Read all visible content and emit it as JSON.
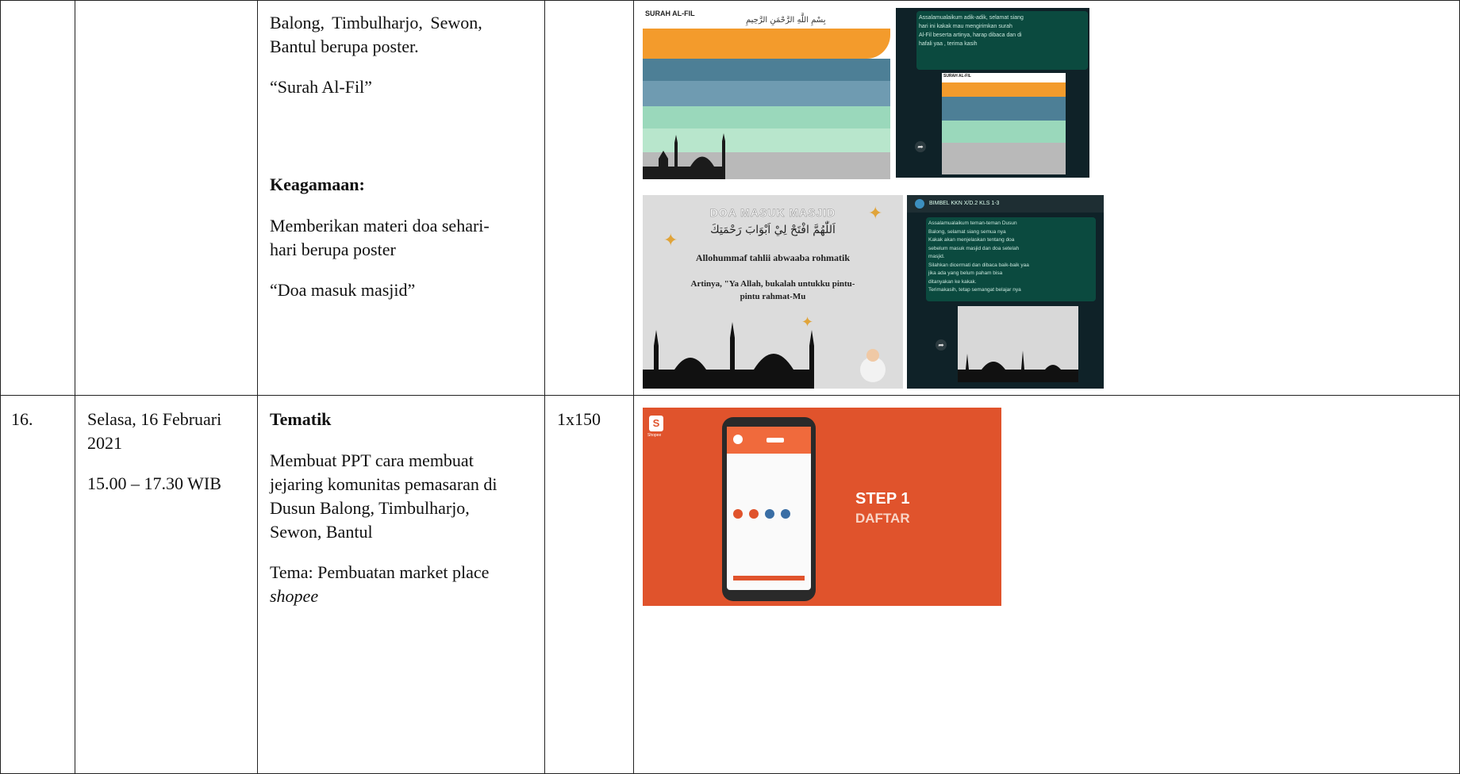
{
  "row15": {
    "desc_line1": "Balong,   Timbulharjo,   Sewon,",
    "desc_line2": "Bantul berupa poster.",
    "desc_quote1": "“Surah Al-Fil”",
    "desc_heading": "Keagamaan:",
    "desc_line3": "Memberikan materi doa sehari-",
    "desc_line4": "hari berupa poster",
    "desc_quote2": "“Doa masuk masjid”",
    "img1": {
      "title": "SURAH AL-FIL",
      "bismillah": "بِسْمِ اللَّهِ الرَّحْمَنِ الرَّحِيمِ"
    },
    "img2": {
      "chat_line1": "Assalamualaikum adik-adik, selamat siang",
      "chat_line2": "hari ini kakak mau mengirimkan surah",
      "chat_line3": "Al-Fil beserta artinya, harap dibaca dan di",
      "chat_line4": "hafali yaa , terima kasih",
      "title": "SURAH AL-FIL"
    },
    "img3": {
      "title": "DOA MASUK MASJID",
      "arabic": "اَللّٰهُمَّ افْتَحْ لِيْ اَبْوَابَ رَحْمَتِكَ",
      "latin": "Allohummaf tahlii abwaaba rohmatik",
      "meaning_line1": "Artinya, \"Ya Allah, bukalah untukku pintu-",
      "meaning_line2": "pintu rahmat-Mu"
    },
    "img4": {
      "header": "BIMBEL KKN X/D.2 KLS 1-3",
      "chat_line1": "Assalamualaikum teman-teman Dusun",
      "chat_line2": "Balong, selamat siang semua nya",
      "chat_line3": "Kakak akan menjelaskan tentang doa",
      "chat_line4": "sebelum masuk masjid dan doa setelah",
      "chat_line5": "masjid.",
      "chat_line6": "Silahkan dicermati dan dibaca baik-baik yaa",
      "chat_line7": "jika ada yang belum paham bisa",
      "chat_line8": "ditanyakan ke kakak.",
      "chat_line9": "Terimakasih, tetap semangat belajar nya"
    }
  },
  "row16": {
    "number": "16.",
    "date_line1": "Selasa, 16 Februari",
    "date_line2": "2021",
    "time": "15.00 – 17.30 WIB",
    "heading": "Tematik",
    "desc_line1": "Membuat PPT cara membuat",
    "desc_line2": "jejaring komunitas pemasaran di",
    "desc_line3": "Dusun Balong, Timbulharjo,",
    "desc_line4": "Sewon, Bantul",
    "tema_prefix": "Tema: Pembuatan market place",
    "tema_italic": "shopee",
    "quantity": "1x150",
    "slide": {
      "logo_letter": "S",
      "logo_label": "Shopee",
      "step_line1": "STEP 1",
      "step_line2": "DAFTAR"
    }
  },
  "colors": {
    "shopee": "#e0532c",
    "chat_bg": "#0f2228",
    "orange_band": "#f39b2c",
    "blue_band": "#4d7f96",
    "green_band": "#8fd3b5"
  }
}
